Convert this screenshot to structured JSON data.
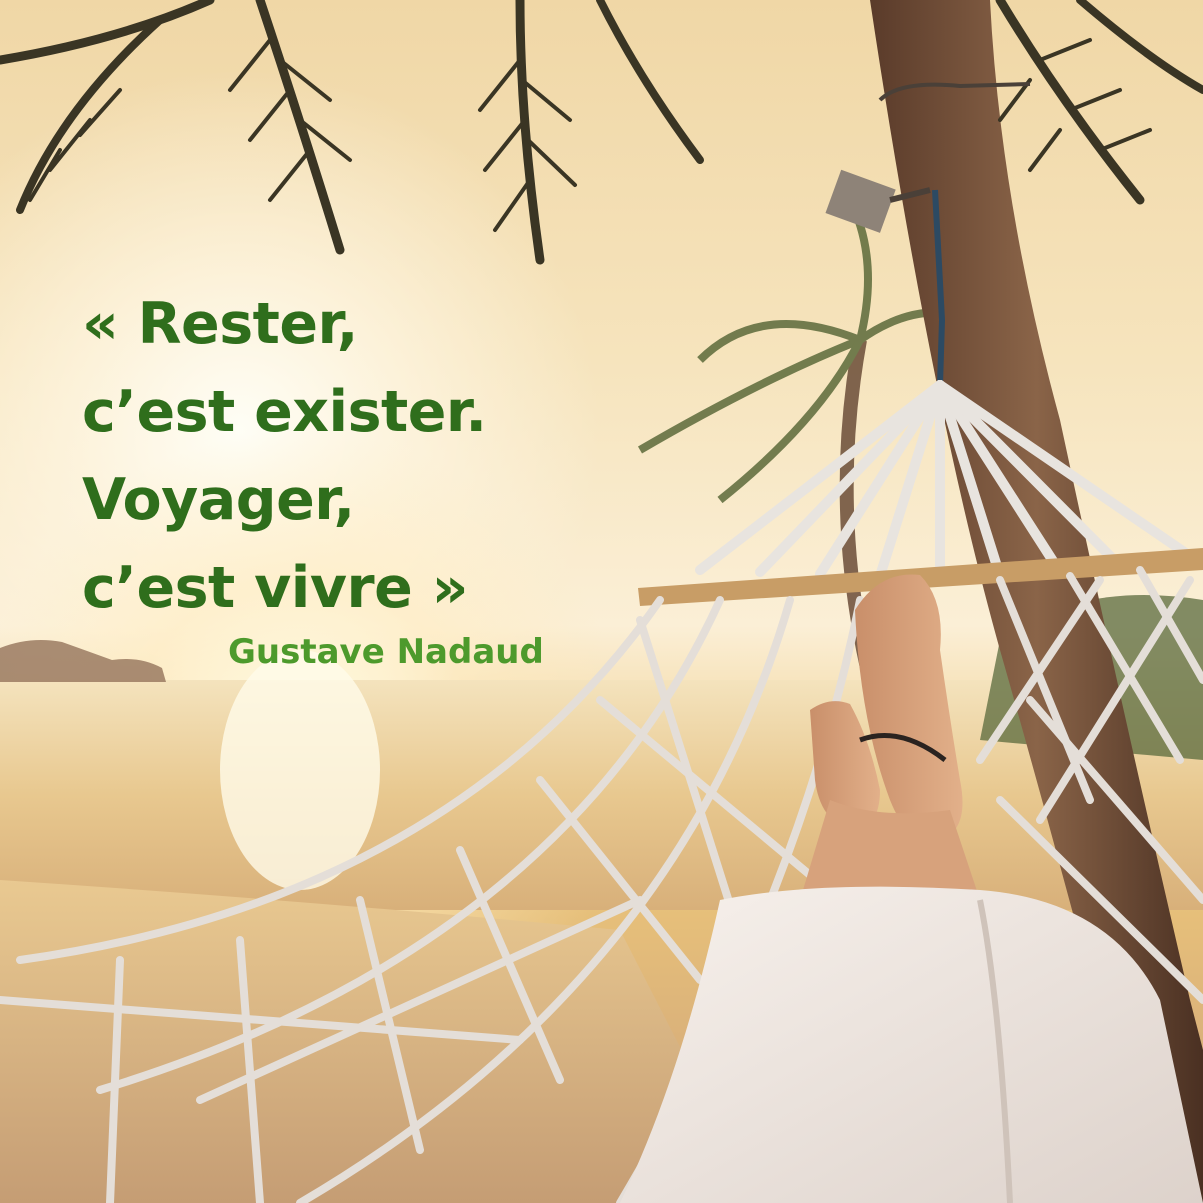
{
  "quote": {
    "lines": [
      "« Rester,",
      "c’est exister.",
      "Voyager,",
      "c’est vivre »"
    ],
    "author": "Gustave Nadaud"
  },
  "colors": {
    "quote_text": "#2f6e1c",
    "author_text": "#4d9a2c",
    "sky": "#f6e4bd",
    "sea": "#e6bf7a",
    "sand": "#caa27a"
  }
}
